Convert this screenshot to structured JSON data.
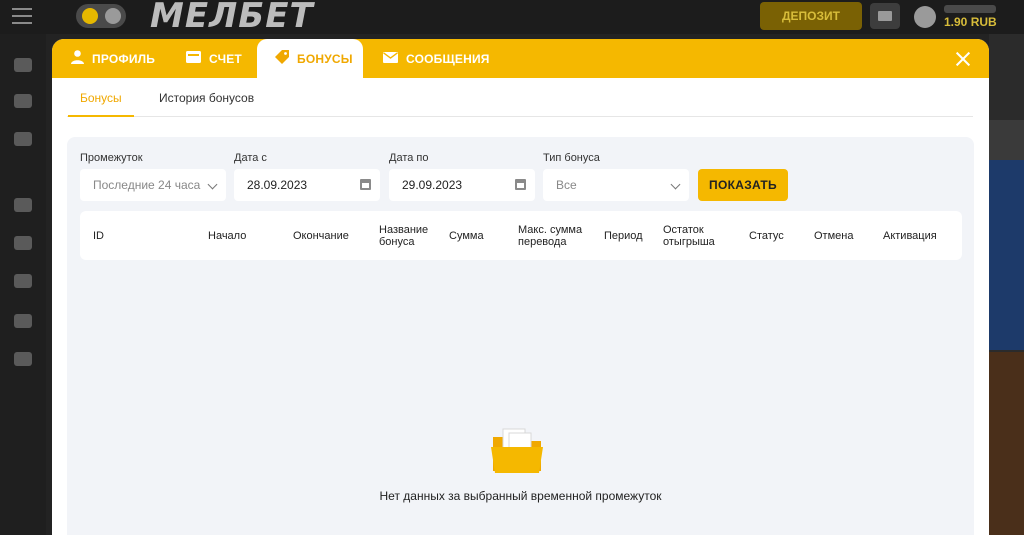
{
  "header": {
    "logo": "МЕЛБЕТ",
    "deposit_label": "ДЕПОЗИТ",
    "balance": "1.90 RUB"
  },
  "modal": {
    "tabs": [
      {
        "label": "ПРОФИЛЬ",
        "icon": "user-icon"
      },
      {
        "label": "СЧЕТ",
        "icon": "wallet-icon"
      },
      {
        "label": "БОНУСЫ",
        "icon": "tag-icon"
      },
      {
        "label": "СООБЩЕНИЯ",
        "icon": "envelope-icon"
      }
    ],
    "active_tab": "БОНУСЫ",
    "subtabs": [
      "Бонусы",
      "История бонусов"
    ]
  },
  "filters": {
    "period": {
      "label": "Промежуток",
      "value": "Последние 24 часа"
    },
    "date_from": {
      "label": "Дата с",
      "value": "28.09.2023"
    },
    "date_to": {
      "label": "Дата по",
      "value": "29.09.2023"
    },
    "bonus_type": {
      "label": "Тип бонуса",
      "value": "Все"
    },
    "show_label": "ПОКАЗАТЬ"
  },
  "table": {
    "columns": [
      "ID",
      "Начало",
      "Окончание",
      "Название бонуса",
      "Сумма",
      "Макс. сумма перевода",
      "Период",
      "Остаток отыгрыша",
      "Статус",
      "Отмена",
      "Активация"
    ]
  },
  "empty_message": "Нет данных за выбранный временной промежуток",
  "colors": {
    "accent": "#f5b800",
    "panel": "#f2f4f8"
  }
}
